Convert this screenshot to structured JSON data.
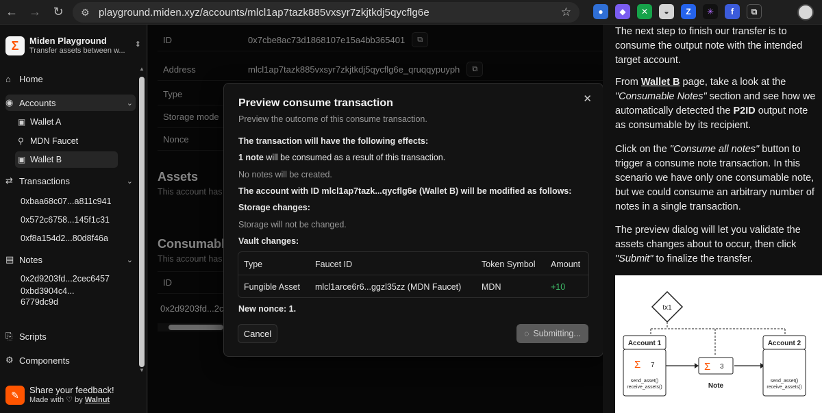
{
  "browser": {
    "url": "playground.miden.xyz/accounts/mlcl1ap7tazk885vxsyr7zkjtkdj5qycflg6e"
  },
  "app": {
    "title": "Miden Playground",
    "subtitle": "Transfer assets between w..."
  },
  "sidebar": {
    "home": "Home",
    "accounts": "Accounts",
    "wallet_a": "Wallet A",
    "mdn_faucet": "MDN Faucet",
    "wallet_b": "Wallet B",
    "transactions": "Transactions",
    "tx1": "0xbaa68c07...a811c941",
    "tx2": "0x572c6758...145f1c31",
    "tx3": "0xf8a154d2...80d8f46a",
    "notes": "Notes",
    "note1": "0x2d9203fd...2cec6457",
    "note2_a": "0xbd3904c4...",
    "note2_b": "6779dc9d",
    "scripts": "Scripts",
    "components": "Components",
    "feedback_title": "Share your feedback!",
    "made_with": "Made with",
    "by": "by",
    "walnut": "Walnut"
  },
  "account": {
    "id_label": "ID",
    "id_value": "0x7cbe8ac73d1868107e15a4bb365401",
    "address_label": "Address",
    "address_value": "mlcl1ap7tazk885vxsyr7zkjtkdj5qycflg6e_qruqqypuyph",
    "type_label": "Type",
    "storage_label": "Storage mode",
    "nonce_label": "Nonce",
    "assets_title": "Assets",
    "assets_sub": "This account has",
    "consumable_title": "Consumable",
    "consumable_sub": "This account has",
    "table_id_header": "ID",
    "table_row_id": "0x2d9203fd...2c"
  },
  "modal": {
    "title": "Preview consume transaction",
    "subtitle": "Preview the outcome of this consume transaction.",
    "effects_heading": "The transaction will have the following effects:",
    "consumed_bold": "1 note",
    "consumed_rest": " will be consumed as a result of this transaction.",
    "no_notes": "No notes will be created.",
    "modified": "The account with ID mlcl1ap7tazk...qycflg6e (Wallet B) will be modified as follows:",
    "storage_heading": "Storage changes:",
    "storage_text": "Storage will not be changed.",
    "vault_heading": "Vault changes:",
    "vault_headers": [
      "Type",
      "Faucet ID",
      "Token Symbol",
      "Amount"
    ],
    "vault_row": [
      "Fungible Asset",
      "mlcl1arce6r6...ggzl35zz (MDN Faucet)",
      "MDN",
      "+10"
    ],
    "nonce": "New nonce: 1.",
    "cancel": "Cancel",
    "submit": "Submitting..."
  },
  "article": {
    "p1": "The next step to finish our transfer is to consume the output note with the intended target account.",
    "p2_a": "From ",
    "p2_link": "Wallet B",
    "p2_b": " page, take a look at the ",
    "p2_italic": "\"Consumable Notes\"",
    "p2_c": " section and see how we automatically detected the ",
    "p2_bold": "P2ID",
    "p2_d": " output note as consumable by its recipient.",
    "p3_a": "Click on the ",
    "p3_italic": "\"Consume all notes\"",
    "p3_b": " button to trigger a consume note transaction. In this scenario we have only one consumable note, but we could consume an arbitrary number of notes in a single transaction.",
    "p4_a": "The preview dialog will let you validate the assets changes about to occur, then click ",
    "p4_italic": "\"Submit\"",
    "p4_b": " to finalize the transfer."
  },
  "diagram": {
    "tx": "tx1",
    "account1": "Account 1",
    "account2": "Account 2",
    "a1_amount": "7",
    "note_amount": "3",
    "note_label": "Note",
    "fn1": "send_asset()",
    "fn2": "receive_assets()"
  }
}
